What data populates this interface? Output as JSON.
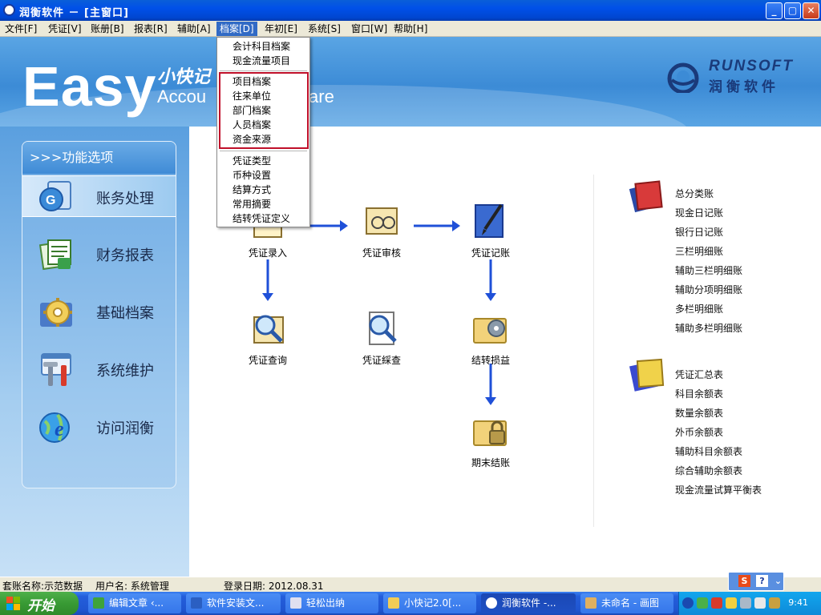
{
  "window": {
    "title": "润衡软件 － [主窗口]",
    "buttons": {
      "minimize": "_",
      "maximize": "▢",
      "close": "✕"
    }
  },
  "menubar": [
    {
      "label": "文件[F]"
    },
    {
      "label": "凭证[V]"
    },
    {
      "label": "账册[B]"
    },
    {
      "label": "报表[R]"
    },
    {
      "label": "辅助[A]"
    },
    {
      "label": "档案[D]",
      "active": true
    },
    {
      "label": "年初[E]"
    },
    {
      "label": "系统[S]"
    },
    {
      "label": "窗口[W]"
    },
    {
      "label": "帮助[H]"
    }
  ],
  "dropdown": {
    "group1": [
      "会计科目档案",
      "现金流量项目"
    ],
    "group2": [
      "项目档案",
      "往来单位",
      "部门档案",
      "人员档案",
      "资金来源"
    ],
    "group3": [
      "凭证类型",
      "币种设置",
      "结算方式",
      "常用摘要",
      "结转凭证定义"
    ]
  },
  "banner": {
    "easy": "Easy",
    "product_cn": "小快记",
    "product_en": "Accou",
    "product_en_tail": "ware",
    "brand_en": "RUNSOFT",
    "brand_cn": "润衡软件"
  },
  "sidebar": {
    "header": ">>>功能选项",
    "items": [
      {
        "label": "账务处理",
        "icon": "accounting-icon",
        "selected": true
      },
      {
        "label": "财务报表",
        "icon": "financial-report-icon"
      },
      {
        "label": "基础档案",
        "icon": "gear-archive-icon"
      },
      {
        "label": "系统维护",
        "icon": "tools-icon"
      },
      {
        "label": "访问润衡",
        "icon": "ie-globe-icon"
      }
    ]
  },
  "flow": {
    "voucher_entry": "凭证录入",
    "voucher_audit": "凭证审核",
    "voucher_post": "凭证记账",
    "voucher_query": "凭证查询",
    "voucher_bind": "凭证綵查",
    "carry_forward": "结转损益",
    "period_close": "期末结账"
  },
  "reports": {
    "books": [
      "总分类账",
      "现金日记账",
      "银行日记账",
      "三栏明细账",
      "辅助三栏明细账",
      "辅助分项明细账",
      "多栏明细账",
      "辅助多栏明细账"
    ],
    "balances": [
      "凭证汇总表",
      "科目余额表",
      "数量余额表",
      "外币余额表",
      "辅助科目余额表",
      "综合辅助余额表",
      "现金流量试算平衡表"
    ]
  },
  "statusbar": {
    "account": "套账名称:示范数据",
    "user": "用户名: 系统管理",
    "login_date": "登录日期: 2012.08.31"
  },
  "taskbar": {
    "start": "开始",
    "tasks": [
      {
        "label": "编辑文章 ‹...",
        "color": "#3fa33a"
      },
      {
        "label": "软件安装文...",
        "color": "#2b5fc2"
      },
      {
        "label": "轻松出纳",
        "color": "#e0e0f0"
      },
      {
        "label": "小快记2.0[...",
        "color": "#f2cc55"
      },
      {
        "label": "润衡软件 -...",
        "color": "#ffffff",
        "active": true
      },
      {
        "label": "未命名 - 画图",
        "color": "#e0b060"
      }
    ],
    "clock": "9:41"
  },
  "colors": {
    "title_bar": "#0050e8",
    "banner_blue": "#3c8bd6",
    "highlight_border": "#c0102a",
    "flow_arrow": "#1f50d8"
  }
}
